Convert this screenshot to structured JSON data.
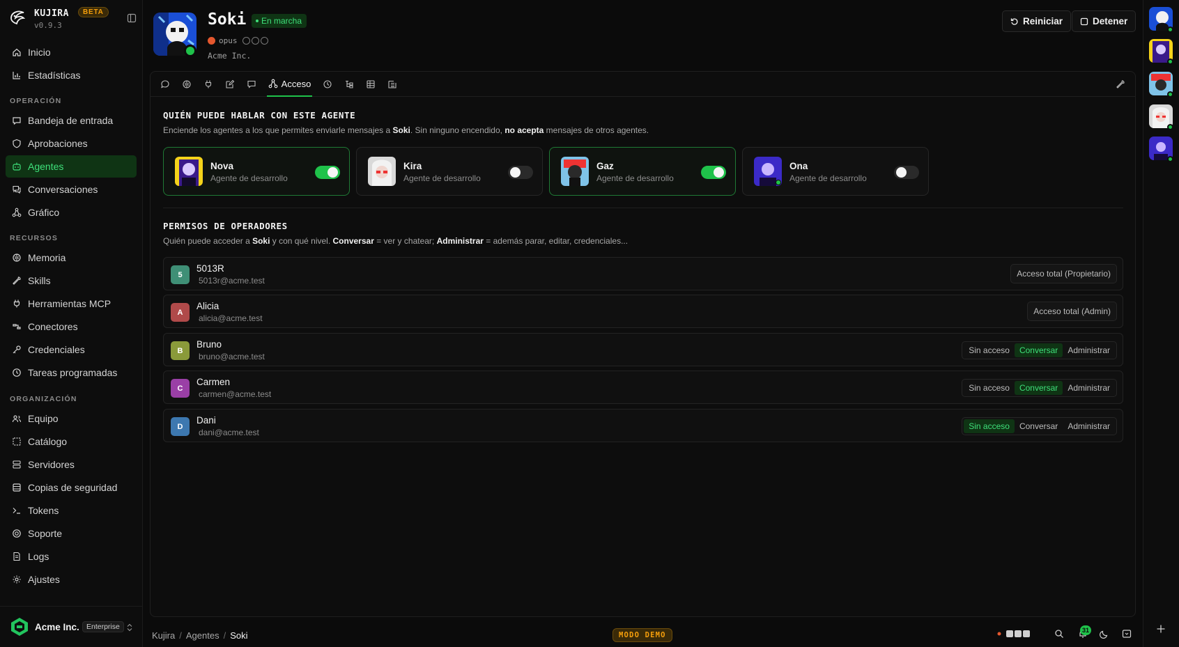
{
  "brand": {
    "name": "KUJIRA",
    "beta": "BETA",
    "version": "v0.9.3"
  },
  "nav": {
    "top": [
      {
        "label": "Inicio",
        "icon": "home-icon"
      },
      {
        "label": "Estadísticas",
        "icon": "bar-chart-icon"
      }
    ],
    "sections": [
      {
        "title": "OPERACIÓN",
        "items": [
          {
            "label": "Bandeja de entrada",
            "icon": "inbox-icon"
          },
          {
            "label": "Aprobaciones",
            "icon": "shield-icon"
          },
          {
            "label": "Agentes",
            "icon": "agents-icon",
            "active": true
          },
          {
            "label": "Conversaciones",
            "icon": "chat-icon"
          },
          {
            "label": "Gráfico",
            "icon": "graph-icon"
          }
        ]
      },
      {
        "title": "RECURSOS",
        "items": [
          {
            "label": "Memoria",
            "icon": "brain-icon"
          },
          {
            "label": "Skills",
            "icon": "wrench-icon"
          },
          {
            "label": "Herramientas MCP",
            "icon": "plug-icon"
          },
          {
            "label": "Conectores",
            "icon": "connector-icon"
          },
          {
            "label": "Credenciales",
            "icon": "key-icon"
          },
          {
            "label": "Tareas programadas",
            "icon": "clock-icon"
          }
        ]
      },
      {
        "title": "ORGANIZACIÓN",
        "items": [
          {
            "label": "Equipo",
            "icon": "users-icon"
          },
          {
            "label": "Catálogo",
            "icon": "catalog-icon"
          },
          {
            "label": "Servidores",
            "icon": "server-icon"
          },
          {
            "label": "Copias de seguridad",
            "icon": "backup-icon"
          },
          {
            "label": "Tokens",
            "icon": "terminal-icon"
          },
          {
            "label": "Soporte",
            "icon": "support-icon"
          },
          {
            "label": "Logs",
            "icon": "logs-icon"
          },
          {
            "label": "Ajustes",
            "icon": "gear-icon"
          }
        ]
      }
    ]
  },
  "org": {
    "name": "Acme Inc.",
    "plan": "Enterprise"
  },
  "agent_header": {
    "name": "Soki",
    "status": "En marcha",
    "model": "opus",
    "org": "Acme Inc.",
    "restart_label": "Reiniciar",
    "stop_label": "Detener"
  },
  "tabs": {
    "active_label": "Acceso"
  },
  "talk_section": {
    "title": "QUIÉN PUEDE HABLAR CON ESTE AGENTE",
    "desc_1": "Enciende los agentes a los que permites enviarle mensajes a ",
    "desc_agent": "Soki",
    "desc_2": ". Sin ninguno encendido, ",
    "desc_strong": "no acepta",
    "desc_3": " mensajes de otros agentes.",
    "agents": [
      {
        "name": "Nova",
        "role": "Agente de desarrollo",
        "enabled": true
      },
      {
        "name": "Kira",
        "role": "Agente de desarrollo",
        "enabled": false
      },
      {
        "name": "Gaz",
        "role": "Agente de desarrollo",
        "enabled": true
      },
      {
        "name": "Ona",
        "role": "Agente de desarrollo",
        "enabled": false
      }
    ]
  },
  "perm_section": {
    "title": "PERMISOS DE OPERADORES",
    "desc_1": "Quién puede acceder a ",
    "desc_agent": "Soki",
    "desc_2": " y con qué nivel. ",
    "desc_conv": "Conversar",
    "desc_3": " = ver y chatear; ",
    "desc_admin": "Administrar",
    "desc_4": " = además parar, editar, credenciales...",
    "options": [
      "Sin acceso",
      "Conversar",
      "Administrar"
    ],
    "operators": [
      {
        "initial": "5",
        "name": "5013R",
        "email": "5013r@acme.test",
        "color": "#3f8f76",
        "tag": "Acceso total (Propietario)"
      },
      {
        "initial": "A",
        "name": "Alicia",
        "email": "alicia@acme.test",
        "color": "#b04a4a",
        "tag": "Acceso total (Admin)"
      },
      {
        "initial": "B",
        "name": "Bruno",
        "email": "bruno@acme.test",
        "color": "#8a9a3a",
        "selected": "Conversar"
      },
      {
        "initial": "C",
        "name": "Carmen",
        "email": "carmen@acme.test",
        "color": "#9a3fa6",
        "selected": "Conversar"
      },
      {
        "initial": "D",
        "name": "Dani",
        "email": "dani@acme.test",
        "color": "#3d78b0",
        "selected": "Sin acceso"
      }
    ]
  },
  "footer": {
    "breadcrumb": [
      "Kujira",
      "Agentes",
      "Soki"
    ],
    "demo_label": "MODO DEMO",
    "notifications": "31"
  },
  "colors": {
    "accent": "#1fc24a",
    "accent_text": "#3ee07a",
    "warning": "#f59e0b"
  }
}
